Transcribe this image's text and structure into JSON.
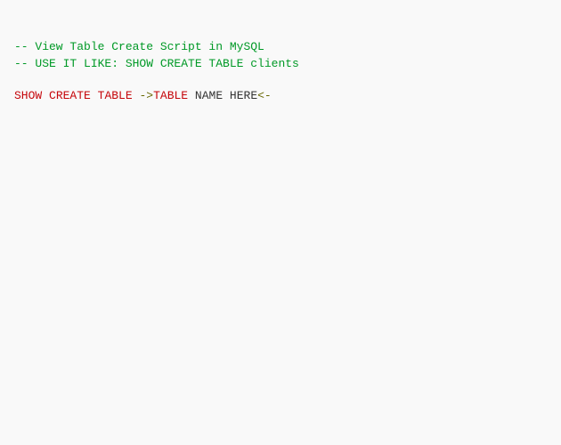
{
  "code": {
    "line1": "-- View Table Create Script in MySQL",
    "line2": "-- USE IT LIKE: SHOW CREATE TABLE clients",
    "line3_kw1": "SHOW",
    "line3_kw2": "CREATE",
    "line3_kw3": "TABLE",
    "line3_op1": "->",
    "line3_kw4": "TABLE",
    "line3_txt": " NAME HERE",
    "line3_op2": "<-"
  }
}
